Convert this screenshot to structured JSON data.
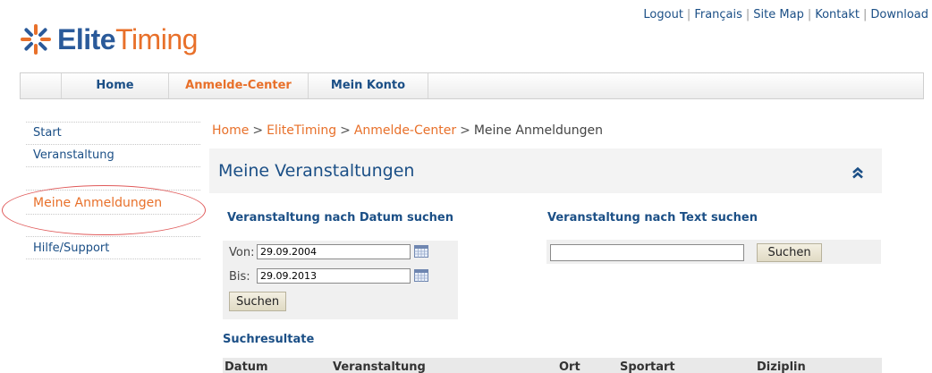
{
  "top_links": [
    "Logout",
    "Français",
    "Site Map",
    "Kontakt",
    "Download"
  ],
  "logo": {
    "word1": "Elite",
    "word2": "Timing",
    "brand_blue": "#2a5a9a",
    "brand_orange": "#e8702a"
  },
  "nav": {
    "home": "Home",
    "anmelde": "Anmelde-Center",
    "konto": "Mein Konto"
  },
  "sidebar": {
    "start": "Start",
    "veranstaltung": "Veranstaltung",
    "active": "Meine Anmeldungen",
    "help": "Hilfe/Support"
  },
  "breadcrumb": {
    "c1": "Home",
    "c2": "EliteTiming",
    "c3": "Anmelde-Center",
    "current": "Meine Anmeldungen",
    "sep": ">"
  },
  "panel": {
    "title": "Meine Veranstaltungen",
    "collapse_icon": "double-chevron-up-icon",
    "date_search": {
      "heading": "Veranstaltung nach Datum suchen",
      "from_label": "Von:",
      "from_value": "29.09.2004",
      "to_label": "Bis:",
      "to_value": "29.09.2013",
      "button": "Suchen",
      "calendar_icon": "calendar-icon"
    },
    "text_search": {
      "heading": "Veranstaltung nach Text suchen",
      "value": "",
      "button": "Suchen"
    },
    "results": {
      "heading": "Suchresultate",
      "columns": [
        "Datum",
        "Veranstaltung",
        "Ort",
        "Sportart",
        "Diziplin"
      ]
    }
  }
}
